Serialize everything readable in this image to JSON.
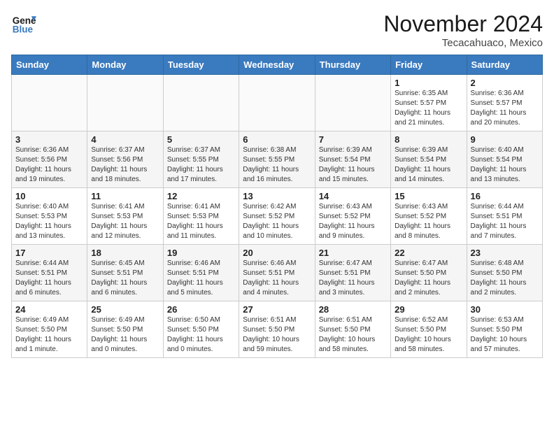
{
  "logo": {
    "line1": "General",
    "line2": "Blue"
  },
  "title": "November 2024",
  "location": "Tecacahuaco, Mexico",
  "weekdays": [
    "Sunday",
    "Monday",
    "Tuesday",
    "Wednesday",
    "Thursday",
    "Friday",
    "Saturday"
  ],
  "weeks": [
    [
      {
        "day": "",
        "info": ""
      },
      {
        "day": "",
        "info": ""
      },
      {
        "day": "",
        "info": ""
      },
      {
        "day": "",
        "info": ""
      },
      {
        "day": "",
        "info": ""
      },
      {
        "day": "1",
        "info": "Sunrise: 6:35 AM\nSunset: 5:57 PM\nDaylight: 11 hours\nand 21 minutes."
      },
      {
        "day": "2",
        "info": "Sunrise: 6:36 AM\nSunset: 5:57 PM\nDaylight: 11 hours\nand 20 minutes."
      }
    ],
    [
      {
        "day": "3",
        "info": "Sunrise: 6:36 AM\nSunset: 5:56 PM\nDaylight: 11 hours\nand 19 minutes."
      },
      {
        "day": "4",
        "info": "Sunrise: 6:37 AM\nSunset: 5:56 PM\nDaylight: 11 hours\nand 18 minutes."
      },
      {
        "day": "5",
        "info": "Sunrise: 6:37 AM\nSunset: 5:55 PM\nDaylight: 11 hours\nand 17 minutes."
      },
      {
        "day": "6",
        "info": "Sunrise: 6:38 AM\nSunset: 5:55 PM\nDaylight: 11 hours\nand 16 minutes."
      },
      {
        "day": "7",
        "info": "Sunrise: 6:39 AM\nSunset: 5:54 PM\nDaylight: 11 hours\nand 15 minutes."
      },
      {
        "day": "8",
        "info": "Sunrise: 6:39 AM\nSunset: 5:54 PM\nDaylight: 11 hours\nand 14 minutes."
      },
      {
        "day": "9",
        "info": "Sunrise: 6:40 AM\nSunset: 5:54 PM\nDaylight: 11 hours\nand 13 minutes."
      }
    ],
    [
      {
        "day": "10",
        "info": "Sunrise: 6:40 AM\nSunset: 5:53 PM\nDaylight: 11 hours\nand 13 minutes."
      },
      {
        "day": "11",
        "info": "Sunrise: 6:41 AM\nSunset: 5:53 PM\nDaylight: 11 hours\nand 12 minutes."
      },
      {
        "day": "12",
        "info": "Sunrise: 6:41 AM\nSunset: 5:53 PM\nDaylight: 11 hours\nand 11 minutes."
      },
      {
        "day": "13",
        "info": "Sunrise: 6:42 AM\nSunset: 5:52 PM\nDaylight: 11 hours\nand 10 minutes."
      },
      {
        "day": "14",
        "info": "Sunrise: 6:43 AM\nSunset: 5:52 PM\nDaylight: 11 hours\nand 9 minutes."
      },
      {
        "day": "15",
        "info": "Sunrise: 6:43 AM\nSunset: 5:52 PM\nDaylight: 11 hours\nand 8 minutes."
      },
      {
        "day": "16",
        "info": "Sunrise: 6:44 AM\nSunset: 5:51 PM\nDaylight: 11 hours\nand 7 minutes."
      }
    ],
    [
      {
        "day": "17",
        "info": "Sunrise: 6:44 AM\nSunset: 5:51 PM\nDaylight: 11 hours\nand 6 minutes."
      },
      {
        "day": "18",
        "info": "Sunrise: 6:45 AM\nSunset: 5:51 PM\nDaylight: 11 hours\nand 6 minutes."
      },
      {
        "day": "19",
        "info": "Sunrise: 6:46 AM\nSunset: 5:51 PM\nDaylight: 11 hours\nand 5 minutes."
      },
      {
        "day": "20",
        "info": "Sunrise: 6:46 AM\nSunset: 5:51 PM\nDaylight: 11 hours\nand 4 minutes."
      },
      {
        "day": "21",
        "info": "Sunrise: 6:47 AM\nSunset: 5:51 PM\nDaylight: 11 hours\nand 3 minutes."
      },
      {
        "day": "22",
        "info": "Sunrise: 6:47 AM\nSunset: 5:50 PM\nDaylight: 11 hours\nand 2 minutes."
      },
      {
        "day": "23",
        "info": "Sunrise: 6:48 AM\nSunset: 5:50 PM\nDaylight: 11 hours\nand 2 minutes."
      }
    ],
    [
      {
        "day": "24",
        "info": "Sunrise: 6:49 AM\nSunset: 5:50 PM\nDaylight: 11 hours\nand 1 minute."
      },
      {
        "day": "25",
        "info": "Sunrise: 6:49 AM\nSunset: 5:50 PM\nDaylight: 11 hours\nand 0 minutes."
      },
      {
        "day": "26",
        "info": "Sunrise: 6:50 AM\nSunset: 5:50 PM\nDaylight: 11 hours\nand 0 minutes."
      },
      {
        "day": "27",
        "info": "Sunrise: 6:51 AM\nSunset: 5:50 PM\nDaylight: 10 hours\nand 59 minutes."
      },
      {
        "day": "28",
        "info": "Sunrise: 6:51 AM\nSunset: 5:50 PM\nDaylight: 10 hours\nand 58 minutes."
      },
      {
        "day": "29",
        "info": "Sunrise: 6:52 AM\nSunset: 5:50 PM\nDaylight: 10 hours\nand 58 minutes."
      },
      {
        "day": "30",
        "info": "Sunrise: 6:53 AM\nSunset: 5:50 PM\nDaylight: 10 hours\nand 57 minutes."
      }
    ]
  ]
}
